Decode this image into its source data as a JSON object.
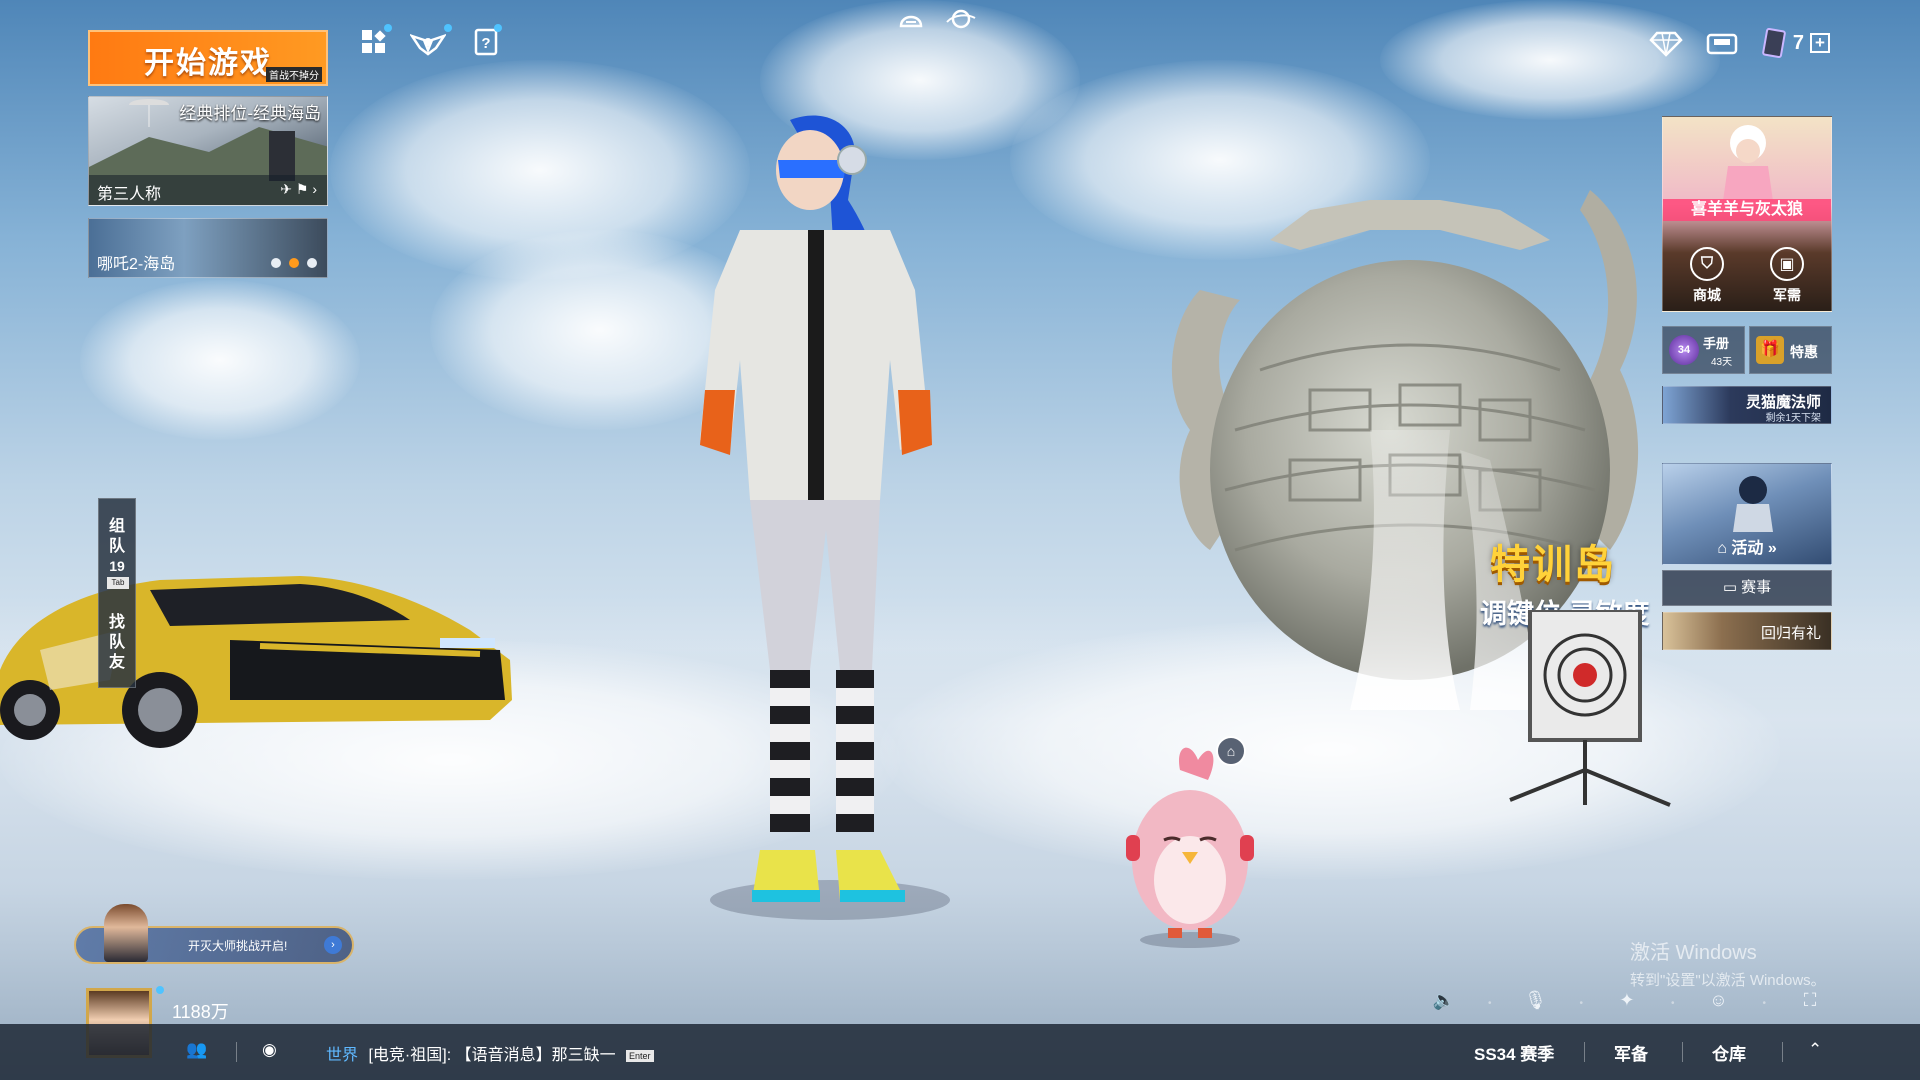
{
  "top_left": {
    "start_button": {
      "label": "开始游戏",
      "sub": "首战不掉分"
    },
    "mode_primary": {
      "title": "经典排位-经典海岛",
      "perspective": "第三人称"
    },
    "mode_secondary": {
      "title": "哪吒2-海岛",
      "carousel_pages": 3,
      "carousel_active": 2
    },
    "icons": [
      "grid-menu-icon",
      "wings-badge-icon",
      "quiz-card-icon"
    ]
  },
  "top_center": {
    "icons": [
      "helmet-icon",
      "globe-icon"
    ]
  },
  "top_right": {
    "icons": [
      "diamond-icon",
      "mailbox-icon",
      "card-icon"
    ],
    "card_count": "7",
    "add_label": "+"
  },
  "right_panel": {
    "promo_title": "喜羊羊与灰太狼",
    "shop_label": "商城",
    "armory_label": "军需",
    "pass": {
      "badge": "34",
      "label": "手册",
      "days": "43天"
    },
    "deals_label": "特惠",
    "event_banner": {
      "title": "灵猫魔法师",
      "subtitle": "剩余1天下架"
    },
    "activity_label": "活动",
    "match_label": "赛事",
    "returns_label": "回归有礼"
  },
  "team_tab": {
    "team_label": [
      "组",
      "队"
    ],
    "count": "19",
    "key": "Tab",
    "find_label": [
      "找",
      "队",
      "友"
    ]
  },
  "training_island": {
    "title": "特训岛",
    "slogan": "调键位,灵敏度"
  },
  "challenge": {
    "text": "开灭大师挑战开启!"
  },
  "profile": {
    "coins": "1188万"
  },
  "chat": {
    "channel": "世界",
    "message": "[电竞·祖国]: 【语音消息】那三缺一",
    "key": "Enter"
  },
  "bottom_nav": {
    "season": "SS34 赛季",
    "armory": "军备",
    "warehouse": "仓库"
  },
  "windows_watermark": {
    "line1": "激活 Windows",
    "line2": "转到\"设置\"以激活 Windows。"
  },
  "colors": {
    "accent_orange": "#ff8a1a",
    "promo_pink": "#ff4678",
    "training_yellow": "#ffd23a",
    "chat_blue": "#5fb8ff"
  }
}
